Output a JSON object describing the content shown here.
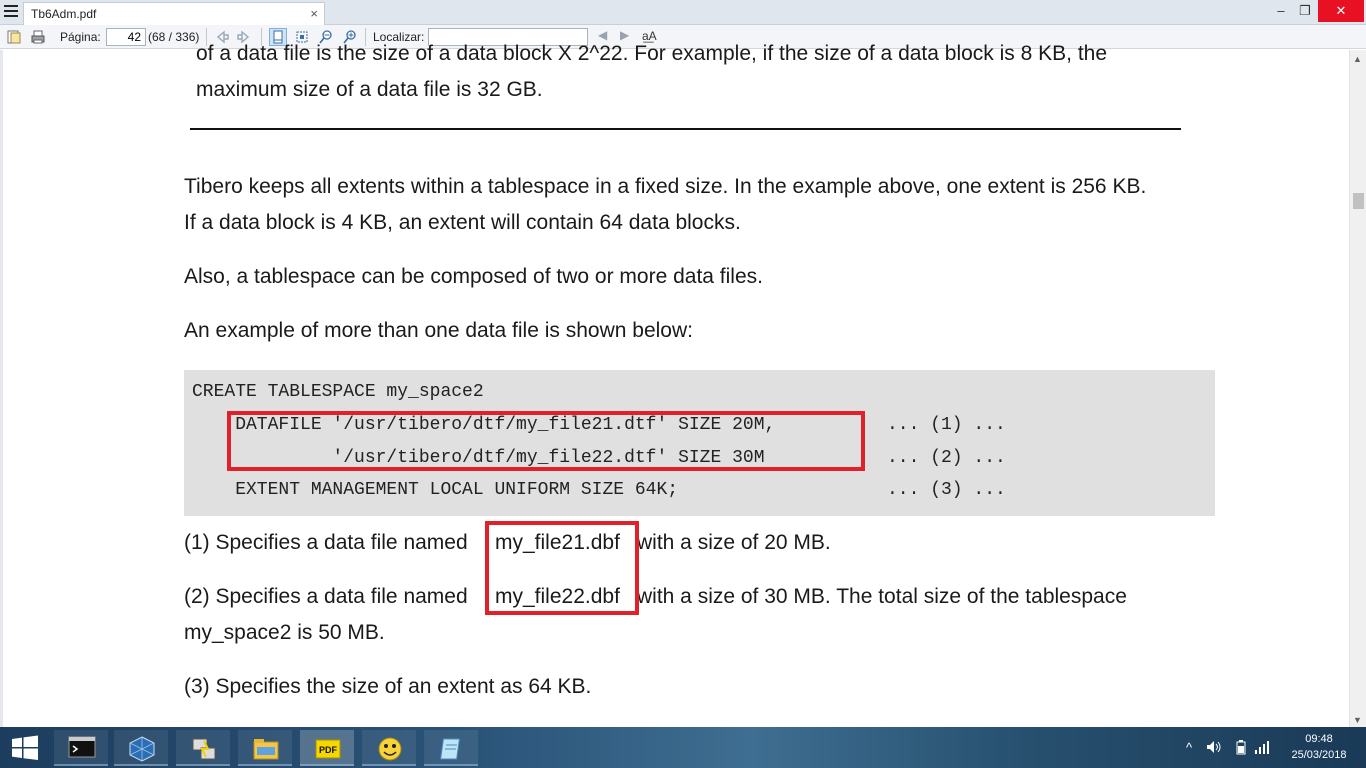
{
  "window": {
    "tab_title": "Tb6Adm.pdf",
    "close_tab": "×",
    "minimize": "–",
    "maximize": "❐",
    "close": "✕"
  },
  "toolbar": {
    "page_label": "Página:",
    "page_value": "42",
    "page_count": "(68 / 336)",
    "find_label": "Localizar:",
    "find_value": "",
    "find_prev": "◀",
    "find_next": "▶",
    "match_case": "a͟A"
  },
  "document": {
    "note_line1": "of a data file is the size of a data block X 2^22. For example, if the size of a data block is 8 KB, the",
    "note_line2": "maximum size of a data file is 32 GB.",
    "para1_line1": "Tibero keeps all extents within a tablespace in a fixed size. In the example above, one extent is 256 KB.",
    "para1_line2": "If a data block is 4 KB, an extent will contain 64 data blocks.",
    "para2": "Also, a tablespace can be composed of two or more data files.",
    "para3": "An example of more than one data file is shown below:",
    "code": {
      "line1": "CREATE TABLESPACE my_space2",
      "line2": "    DATAFILE '/usr/tibero/dtf/my_file21.dtf' SIZE 20M,",
      "line3": "             '/usr/tibero/dtf/my_file22.dtf' SIZE 30M",
      "line4": "    EXTENT MANAGEMENT LOCAL UNIFORM SIZE 64K;",
      "ref1": "... (1) ...",
      "ref2": "... (2) ...",
      "ref3": "... (3) ..."
    },
    "item1_prefix": "(1) Specifies a data file named",
    "item1_file": "my_file21.dbf",
    "item1_suffix": "with a size of 20 MB.",
    "item2_prefix": "(2) Specifies a data file named",
    "item2_file": "my_file22.dbf",
    "item2_suffix": "with a size of 30 MB. The total size of the tablespace",
    "item2_line2": "my_space2 is 50 MB.",
    "item3": "(3) Specifies the size of an extent as 64 KB."
  },
  "scrollbar": {
    "up": "▲",
    "down": "▼"
  },
  "taskbar": {
    "apps": [
      "cmd-icon",
      "virtualbox-icon",
      "putty-icon",
      "file-explorer-icon",
      "pdf-reader-icon",
      "emoji-app-icon",
      "notepad-icon"
    ],
    "time": "09:48",
    "date": "25/03/2018",
    "tray_chevron": "^"
  },
  "colors": {
    "highlight_box": "#e0202a",
    "code_background": "#e0e0e0"
  }
}
